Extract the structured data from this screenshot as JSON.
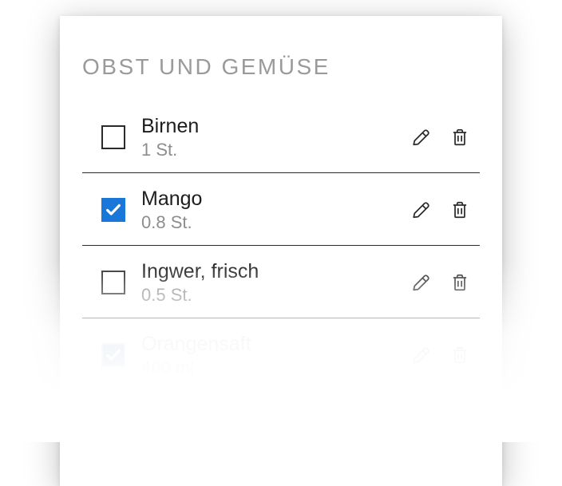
{
  "section_title": "Obst und Gemüse",
  "items": [
    {
      "name": "Birnen",
      "quantity": "1 St.",
      "checked": false
    },
    {
      "name": "Mango",
      "quantity": "0.8 St.",
      "checked": true
    },
    {
      "name": "Ingwer, frisch",
      "quantity": "0.5 St.",
      "checked": false
    },
    {
      "name": "Orangensaft",
      "quantity": "400 ml",
      "checked": true
    }
  ]
}
